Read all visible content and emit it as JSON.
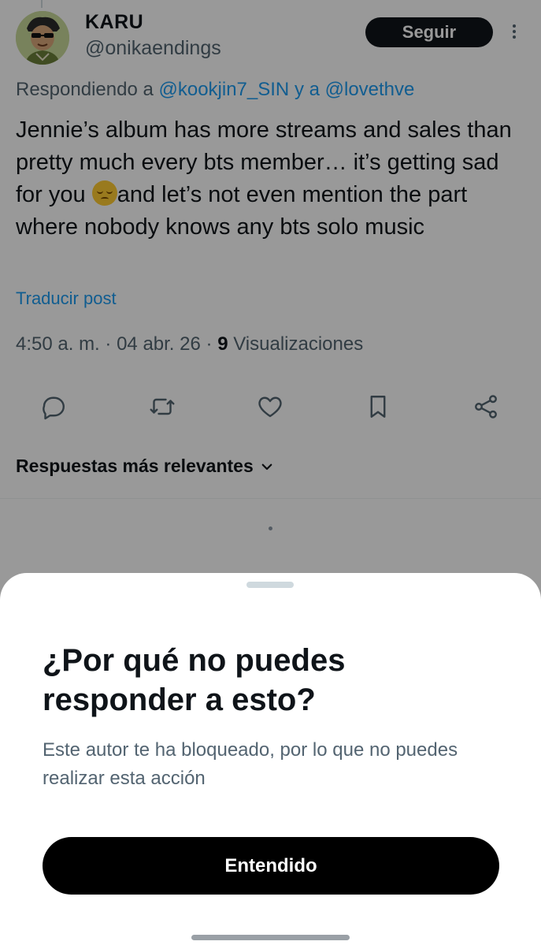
{
  "tweet": {
    "display_name": "KARU",
    "handle": "@onikaendings",
    "follow_label": "Seguir",
    "replying_prefix": "Respondiendo a",
    "replying_user_1": "@kookjin7_SIN",
    "replying_joiner": "y a",
    "replying_user_2": "@lovethve",
    "text_part1": "Jennie’s album has more streams and sales than pretty much every bts member… it’s getting sad for you",
    "text_part2": "and let’s not even mention the part where nobody knows any bts solo music",
    "emoji_name": "pensive-face-emoji",
    "translate_label": "Traducir post",
    "time": "4:50 a. m.",
    "date": "04 abr. 26",
    "views_count": "9",
    "views_label": "Visualizaciones"
  },
  "actions": {
    "icons": [
      "reply-icon",
      "retweet-icon",
      "like-icon",
      "bookmark-icon",
      "share-icon"
    ]
  },
  "replies_sort": {
    "label": "Respuestas más relevantes"
  },
  "sheet": {
    "title": "¿Por qué no puedes responder a esto?",
    "body": "Este autor te ha bloqueado, por lo que no puedes realizar esta acción",
    "button_label": "Entendido"
  },
  "colors": {
    "accent_link": "#1d9bf0",
    "text_primary": "#0f1419",
    "text_secondary": "#536471",
    "overlay": "rgba(0,0,0,0.4)",
    "button_bg": "#000000"
  }
}
